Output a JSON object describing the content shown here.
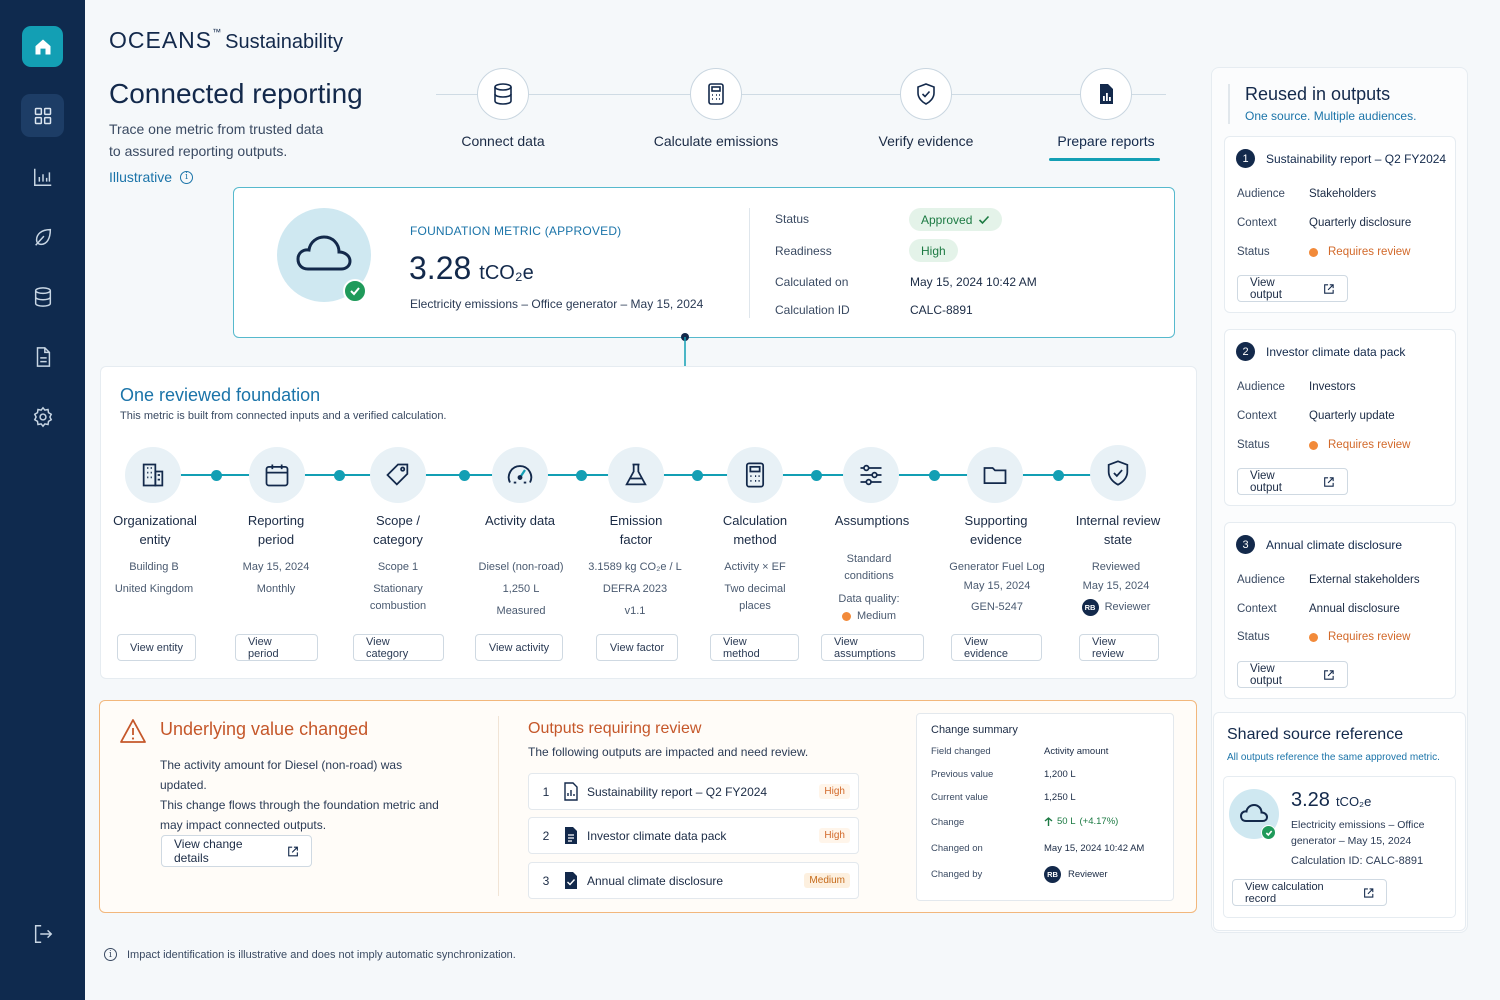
{
  "brand": {
    "name": "OCEANS",
    "tm": "™",
    "suffix": "Sustainability"
  },
  "sidebar": {
    "items": [
      "home-icon",
      "dashboard-icon",
      "analytics-icon",
      "leaf-icon",
      "database-icon",
      "document-icon",
      "settings-icon",
      "logout-icon"
    ]
  },
  "header": {
    "title": "Connected reporting",
    "subtitle_line1": "Trace one metric from trusted data",
    "subtitle_line2": "to assured reporting outputs.",
    "illustrative": "Illustrative",
    "info_glyph": "i"
  },
  "steps": [
    {
      "label": "Connect data",
      "icon": "database-icon"
    },
    {
      "label": "Calculate emissions",
      "icon": "calculator-icon"
    },
    {
      "label": "Verify evidence",
      "icon": "shield-check-icon"
    },
    {
      "label": "Prepare reports",
      "icon": "report-icon",
      "active": true
    }
  ],
  "foundation": {
    "label": "FOUNDATION METRIC (APPROVED)",
    "value": "3.28",
    "unit": "tCO₂e",
    "description": "Electricity emissions – Office generator – May 15, 2024",
    "status_label": "Status",
    "status_value": "Approved",
    "readiness_label": "Readiness",
    "readiness_value": "High",
    "calculated_label": "Calculated on",
    "calculated_value": "May 15, 2024 10:42 AM",
    "calcid_label": "Calculation ID",
    "calcid_value": "CALC-8891"
  },
  "reviewed": {
    "title": "One reviewed foundation",
    "subtitle": "This metric is built from connected inputs and a verified calculation.",
    "columns": [
      {
        "title1": "Organizational",
        "title2": "entity",
        "d1": "Building B",
        "d2": "United Kingdom",
        "button": "View entity"
      },
      {
        "title1": "Reporting",
        "title2": "period",
        "d1": "May 15, 2024",
        "d2": "Monthly",
        "button": "View period"
      },
      {
        "title1": "Scope /",
        "title2": "category",
        "d1": "Scope 1",
        "d2": "Stationary",
        "d3": "combustion",
        "button": "View category"
      },
      {
        "title1": "Activity data",
        "d1": "Diesel (non-road)",
        "d2": "1,250 L",
        "d3": "Measured",
        "button": "View activity"
      },
      {
        "title1": "Emission",
        "title2": "factor",
        "d1": "3.1589 kg CO₂e / L",
        "d2": "DEFRA 2023",
        "d3": "v1.1",
        "button": "View factor"
      },
      {
        "title1": "Calculation",
        "title2": "method",
        "d1": "Activity × EF",
        "d2": "Two decimal",
        "d3": "places",
        "button": "View method"
      },
      {
        "title1": "Assumptions",
        "d1": "Standard",
        "d2": "conditions",
        "d3": "Data quality:",
        "d4": "Medium",
        "button": "View assumptions"
      },
      {
        "title1": "Supporting",
        "title2": "evidence",
        "d1": "Generator Fuel Log",
        "d2": "May 15, 2024",
        "d3": "GEN-5247",
        "button": "View evidence"
      },
      {
        "title1": "Internal review",
        "title2": "state",
        "d1": "Reviewed",
        "d2": "May 15, 2024",
        "d3": "Reviewer",
        "avatar": "RB",
        "button": "View review"
      }
    ]
  },
  "alert": {
    "title": "Underlying value changed",
    "line1": "The activity amount for Diesel (non-road) was updated.",
    "line2": "This change flows through the foundation metric and",
    "line3": "may impact connected outputs.",
    "button": "View change details"
  },
  "outputs_review": {
    "title": "Outputs requiring review",
    "subtitle": "The following outputs are impacted and need review.",
    "rows": [
      {
        "num": "1",
        "name": "Sustainability report – Q2 FY2024",
        "severity": "High"
      },
      {
        "num": "2",
        "name": "Investor climate data pack",
        "severity": "High"
      },
      {
        "num": "3",
        "name": "Annual climate disclosure",
        "severity": "Medium"
      }
    ]
  },
  "change_summary": {
    "title": "Change summary",
    "rows": [
      {
        "k": "Field changed",
        "v": "Activity amount"
      },
      {
        "k": "Previous value",
        "v": "1,200 L"
      },
      {
        "k": "Current value",
        "v": "1,250 L"
      },
      {
        "k": "Change",
        "v": "50 L",
        "extra": "(+4.17%)"
      },
      {
        "k": "Changed on",
        "v": "May 15, 2024 10:42 AM"
      },
      {
        "k": "Changed by",
        "v": "Reviewer",
        "avatar": "RB"
      }
    ]
  },
  "footnote": "Impact identification is illustrative and does not imply automatic synchronization.",
  "reused": {
    "title": "Reused in outputs",
    "subtitle": "One source. Multiple audiences.",
    "labels": {
      "audience": "Audience",
      "context": "Context",
      "status": "Status"
    },
    "outputs": [
      {
        "num": "1",
        "name": "Sustainability report – Q2 FY2024",
        "audience": "Stakeholders",
        "context": "Quarterly disclosure",
        "status": "Requires review",
        "button": "View output"
      },
      {
        "num": "2",
        "name": "Investor climate data pack",
        "audience": "Investors",
        "context": "Quarterly update",
        "status": "Requires review",
        "button": "View output"
      },
      {
        "num": "3",
        "name": "Annual climate disclosure",
        "audience": "External stakeholders",
        "context": "Annual disclosure",
        "status": "Requires review",
        "button": "View output"
      }
    ]
  },
  "shared": {
    "title": "Shared source reference",
    "subtitle": "All outputs reference the same approved metric.",
    "value": "3.28",
    "unit": "tCO₂e",
    "desc1": "Electricity emissions – Office",
    "desc2": "generator – May 15, 2024",
    "calcid": "Calculation ID: CALC-8891",
    "button": "View calculation record"
  },
  "colors": {
    "sidebar": "#0f2a4e",
    "accent": "#139fb4",
    "link": "#1b74a9",
    "warning": "#c5572a",
    "approved": "#1c7a43",
    "status_dot": "#f28a3a"
  }
}
